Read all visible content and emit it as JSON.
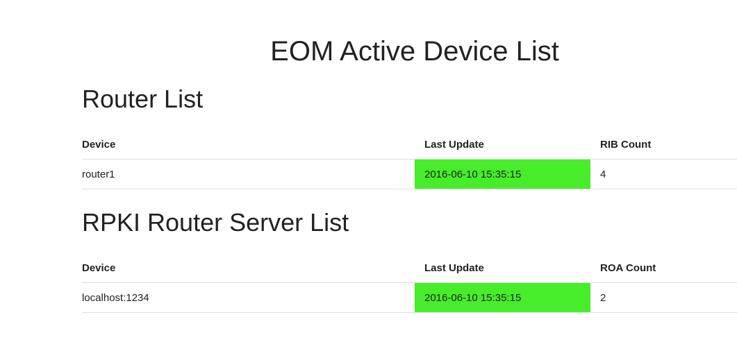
{
  "page": {
    "title": "EOM Active Device List"
  },
  "router_list": {
    "heading": "Router List",
    "columns": [
      "Device",
      "Last Update",
      "RIB Count"
    ],
    "rows": [
      {
        "device": "router1",
        "last_update": "2016-06-10 15:35:15",
        "count": "4"
      }
    ]
  },
  "rpki_list": {
    "heading": "RPKI Router Server List",
    "columns": [
      "Device",
      "Last Update",
      "ROA Count"
    ],
    "rows": [
      {
        "device": "localhost:1234",
        "last_update": "2016-06-10 15:35:15",
        "count": "2"
      }
    ]
  },
  "colors": {
    "status_ok": "#47ed2a"
  }
}
